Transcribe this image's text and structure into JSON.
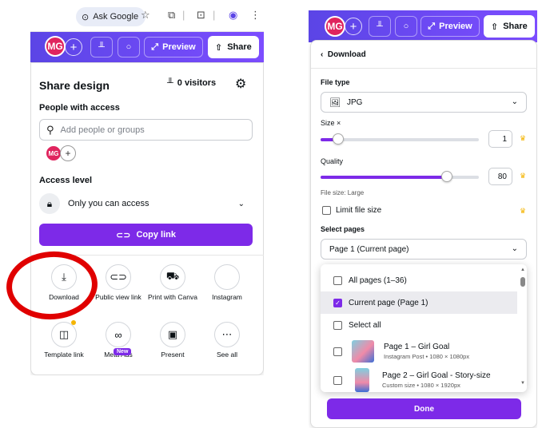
{
  "browser": {
    "ask_google": "Ask Google"
  },
  "toolbar": {
    "avatar_initials": "MG",
    "preview_label": "Preview",
    "share_label": "Share"
  },
  "share_panel": {
    "title": "Share design",
    "visitors": "0 visitors",
    "people_with_access_label": "People with access",
    "search_placeholder": "Add people or groups",
    "avatar_initials": "MG",
    "access_level_label": "Access level",
    "access_value": "Only you can access",
    "copy_link_label": "Copy link",
    "options": [
      {
        "label": "Download",
        "icon": "download-icon"
      },
      {
        "label": "Public view link",
        "icon": "link-icon"
      },
      {
        "label": "Print with Canva",
        "icon": "truck-icon"
      },
      {
        "label": "Instagram",
        "icon": "instagram-icon"
      },
      {
        "label": "Template link",
        "icon": "template-icon"
      },
      {
        "label": "Meta Ads",
        "icon": "meta-icon",
        "badge": "New"
      },
      {
        "label": "Present",
        "icon": "present-icon"
      },
      {
        "label": "See all",
        "icon": "more-icon"
      }
    ]
  },
  "download_panel": {
    "back_label": "Download",
    "file_type_label": "File type",
    "file_type_value": "JPG",
    "size_label": "Size ×",
    "size_value": "1",
    "size_fraction": 0.11,
    "quality_label": "Quality",
    "quality_value": "80",
    "quality_fraction": 0.8,
    "file_size_text": "File size: Large",
    "limit_file_size_label": "Limit file size",
    "select_pages_label": "Select pages",
    "select_pages_value": "Page 1 (Current page)",
    "dropdown": {
      "all_pages": "All pages (1–36)",
      "current_page": "Current page (Page 1)",
      "select_all": "Select all",
      "pages": [
        {
          "title": "Page 1 – Girl Goal",
          "subtitle": "Instagram Post • 1080 × 1080px"
        },
        {
          "title": "Page 2 – Girl Goal - Story-size",
          "subtitle": "Custom size • 1080 × 1920px"
        }
      ]
    },
    "done_label": "Done"
  },
  "colors": {
    "brand_purple": "#7d2ae8",
    "toolbar_gradient_start": "#5b45e6",
    "annotation_red": "#e00000",
    "avatar_red": "#e0245e"
  }
}
